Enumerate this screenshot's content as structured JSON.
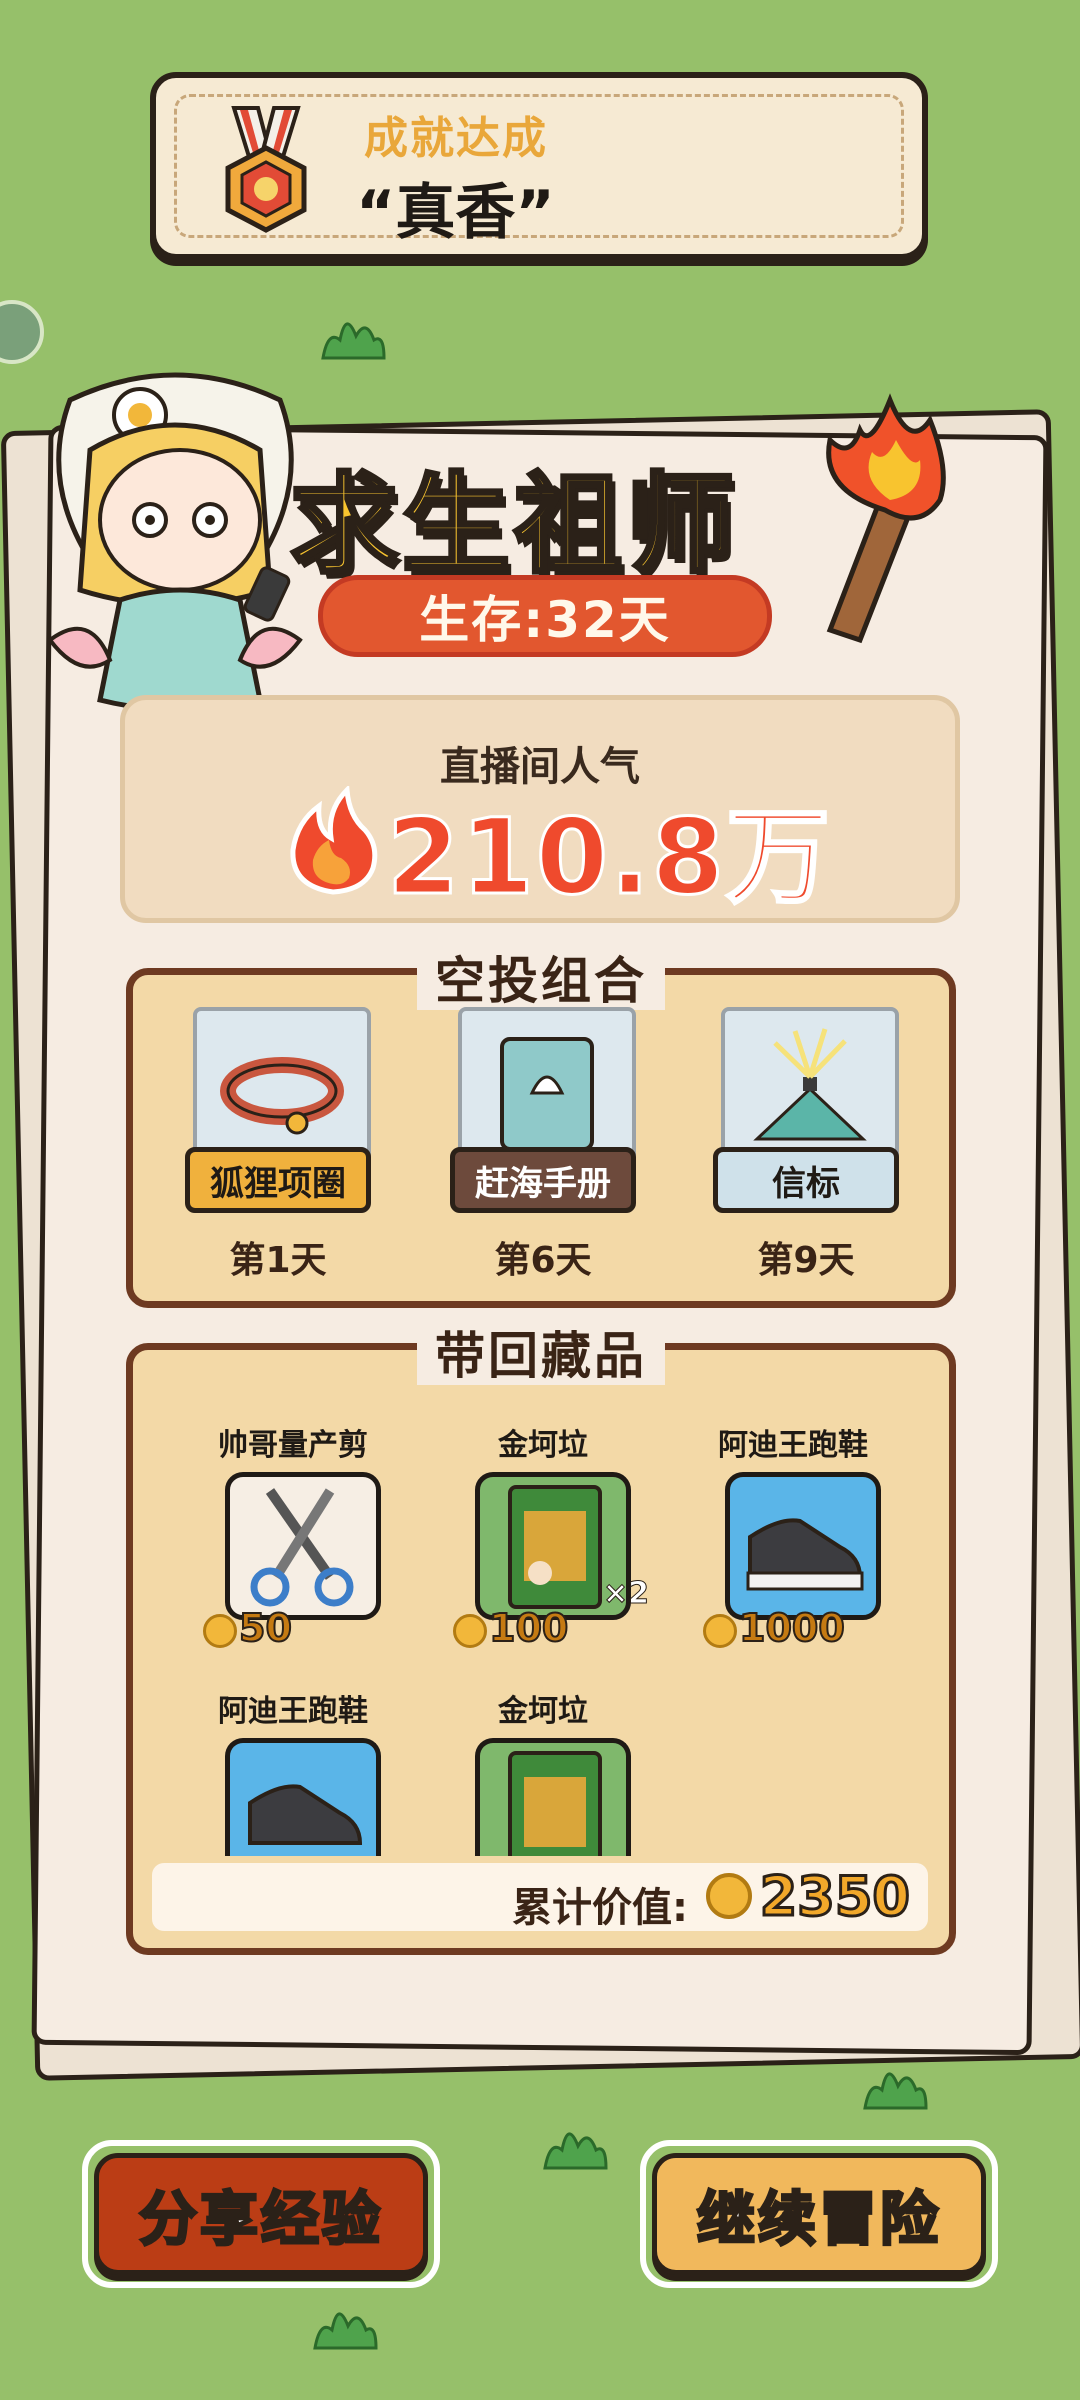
{
  "achievement": {
    "label": "成就达成",
    "name": "“真香”"
  },
  "header": {
    "title": "求生祖师",
    "survival": "生存:32天"
  },
  "popularity": {
    "label": "直播间人气",
    "value": "210.8万"
  },
  "airdrop": {
    "title": "空投组合",
    "items": [
      {
        "name": "狐狸项圈",
        "day": "第1天",
        "icon": "fox-collar-icon",
        "tag_color": "#f0b13d"
      },
      {
        "name": "赶海手册",
        "day": "第6天",
        "icon": "seashell-book-icon",
        "tag_color": "#6d4a3c"
      },
      {
        "name": "信标",
        "day": "第9天",
        "icon": "beacon-icon",
        "tag_color": "#cfe1ea"
      }
    ]
  },
  "loot": {
    "title": "带回藏品",
    "items": [
      {
        "name": "帅哥量产剪",
        "price": "50",
        "icon": "scissors-icon",
        "bg": "#f6eee4"
      },
      {
        "name": "金坷垃",
        "price": "100",
        "badge": "×2",
        "icon": "fertilizer-bag-icon",
        "bg": "#7fb86c"
      },
      {
        "name": "阿迪王跑鞋",
        "price": "1000",
        "icon": "sneaker-icon",
        "bg": "#5ab5e8"
      },
      {
        "name": "阿迪王跑鞋",
        "icon": "sneaker-icon",
        "bg": "#5ab5e8"
      },
      {
        "name": "金坷垃",
        "icon": "fertilizer-bag-icon",
        "bg": "#7fb86c"
      }
    ],
    "total_label": "累计价值:",
    "total_value": "2350"
  },
  "buttons": {
    "share": "分享经验",
    "continue": "继续冒险"
  },
  "colors": {
    "background": "#96c06a",
    "title_yellow": "#f8c42f",
    "popularity_red": "#ef4a2d",
    "share_button": "#bb3d15",
    "continue_button": "#f1b85c"
  }
}
